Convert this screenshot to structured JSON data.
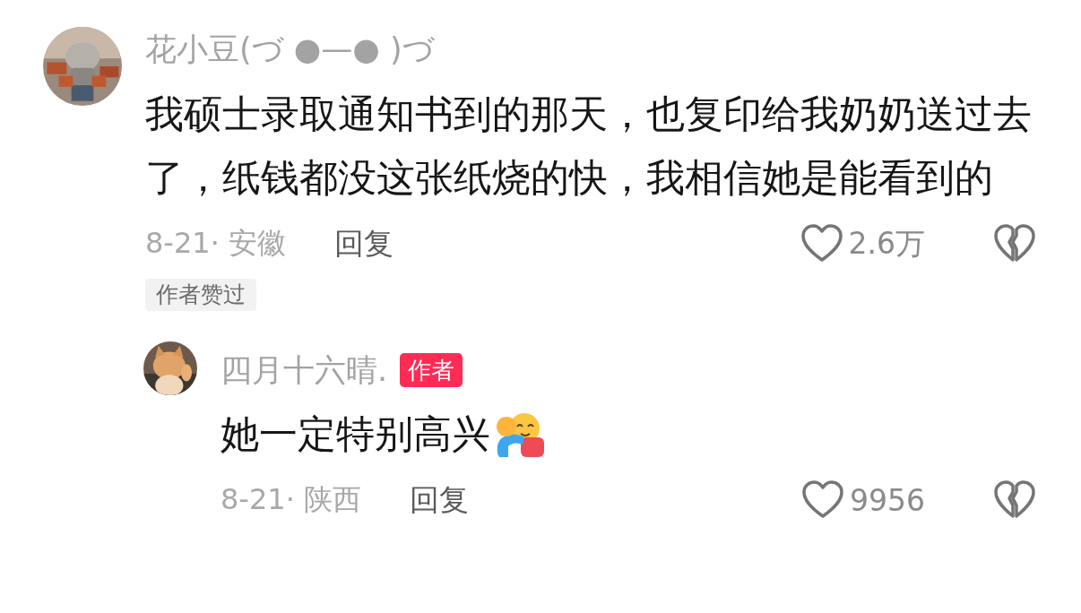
{
  "comments": [
    {
      "user": {
        "name": "花小豆(づ ●—● )づ"
      },
      "text": "我硕士录取通知书到的那天，也复印给我奶奶送过去了，纸钱都没这张纸烧的快，我相信她是能看到的",
      "date": "8-21· 安徽",
      "reply_label": "回复",
      "likes": "2.6万",
      "tags": [
        "作者赞过"
      ],
      "replies": [
        {
          "user": {
            "name": "四月十六晴.",
            "badge": "作者"
          },
          "text": "她一定特别高兴",
          "date": "8-21· 陕西",
          "reply_label": "回复",
          "likes": "9956"
        }
      ]
    }
  ]
}
